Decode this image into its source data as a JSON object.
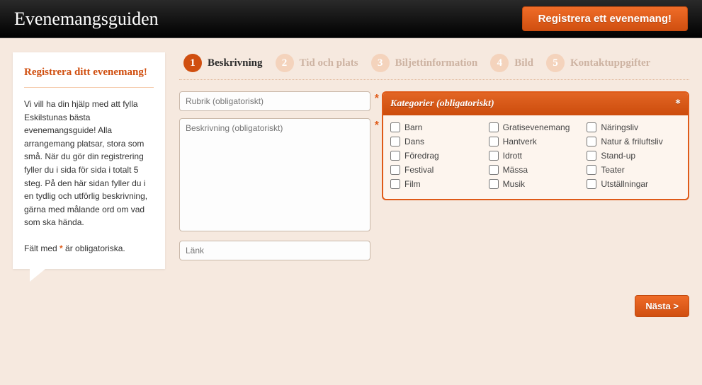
{
  "header": {
    "site_title": "Evenemangsguiden",
    "register_button": "Registrera ett evenemang!"
  },
  "sidebar": {
    "title": "Registrera ditt evenemang!",
    "body": "Vi vill ha din hjälp med att fylla Eskilstunas bästa evenemangsguide! Alla arrangemang platsar, stora som små. När du gör din registrering fyller du i sida för sida i totalt 5 steg. På den här sidan fyller du i en tydlig och utförlig beskrivning, gärna med målande ord om vad som ska hända.",
    "note_prefix": "Fält med ",
    "note_suffix": " är obligatoriska."
  },
  "steps": [
    {
      "num": "1",
      "label": "Beskrivning",
      "active": true
    },
    {
      "num": "2",
      "label": "Tid och plats",
      "active": false
    },
    {
      "num": "3",
      "label": "Biljettinformation",
      "active": false
    },
    {
      "num": "4",
      "label": "Bild",
      "active": false
    },
    {
      "num": "5",
      "label": "Kontaktuppgifter",
      "active": false
    }
  ],
  "form": {
    "title_placeholder": "Rubrik (obligatoriskt)",
    "title_value": "",
    "description_placeholder": "Beskrivning (obligatoriskt)",
    "description_value": "",
    "link_placeholder": "Länk",
    "link_value": ""
  },
  "categories": {
    "header": "Kategorier (obligatoriskt)",
    "columns": [
      [
        "Barn",
        "Dans",
        "Föredrag",
        "Festival",
        "Film"
      ],
      [
        "Gratisevenemang",
        "Hantverk",
        "Idrott",
        "Mässa",
        "Musik"
      ],
      [
        "Näringsliv",
        "Natur & friluftsliv",
        "Stand-up",
        "Teater",
        "Utställningar"
      ]
    ]
  },
  "buttons": {
    "next": "Nästa >"
  }
}
